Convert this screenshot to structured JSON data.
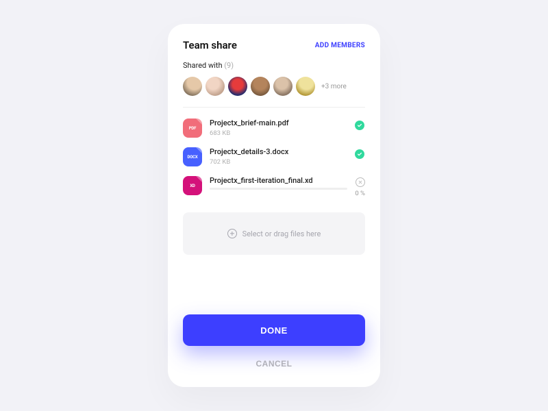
{
  "header": {
    "title": "Team share",
    "add_members_label": "ADD MEMBERS"
  },
  "shared": {
    "label": "Shared with",
    "count": "(9)",
    "more": "+3 more"
  },
  "files": [
    {
      "name": "Projectx_brief-main.pdf",
      "size": "683 KB",
      "ext": "PDF",
      "status": "done"
    },
    {
      "name": "Projectx_details-3.docx",
      "size": "702 KB",
      "ext": "DOCX",
      "status": "done"
    },
    {
      "name": "Projectx_first-iteration_final.xd",
      "size": "",
      "ext": "XD",
      "status": "uploading",
      "progress_pct": "0 %"
    }
  ],
  "dropzone": {
    "label": "Select or drag files here"
  },
  "actions": {
    "done": "DONE",
    "cancel": "CANCEL"
  },
  "colors": {
    "accent": "#3d3fff",
    "success": "#30d99d"
  }
}
